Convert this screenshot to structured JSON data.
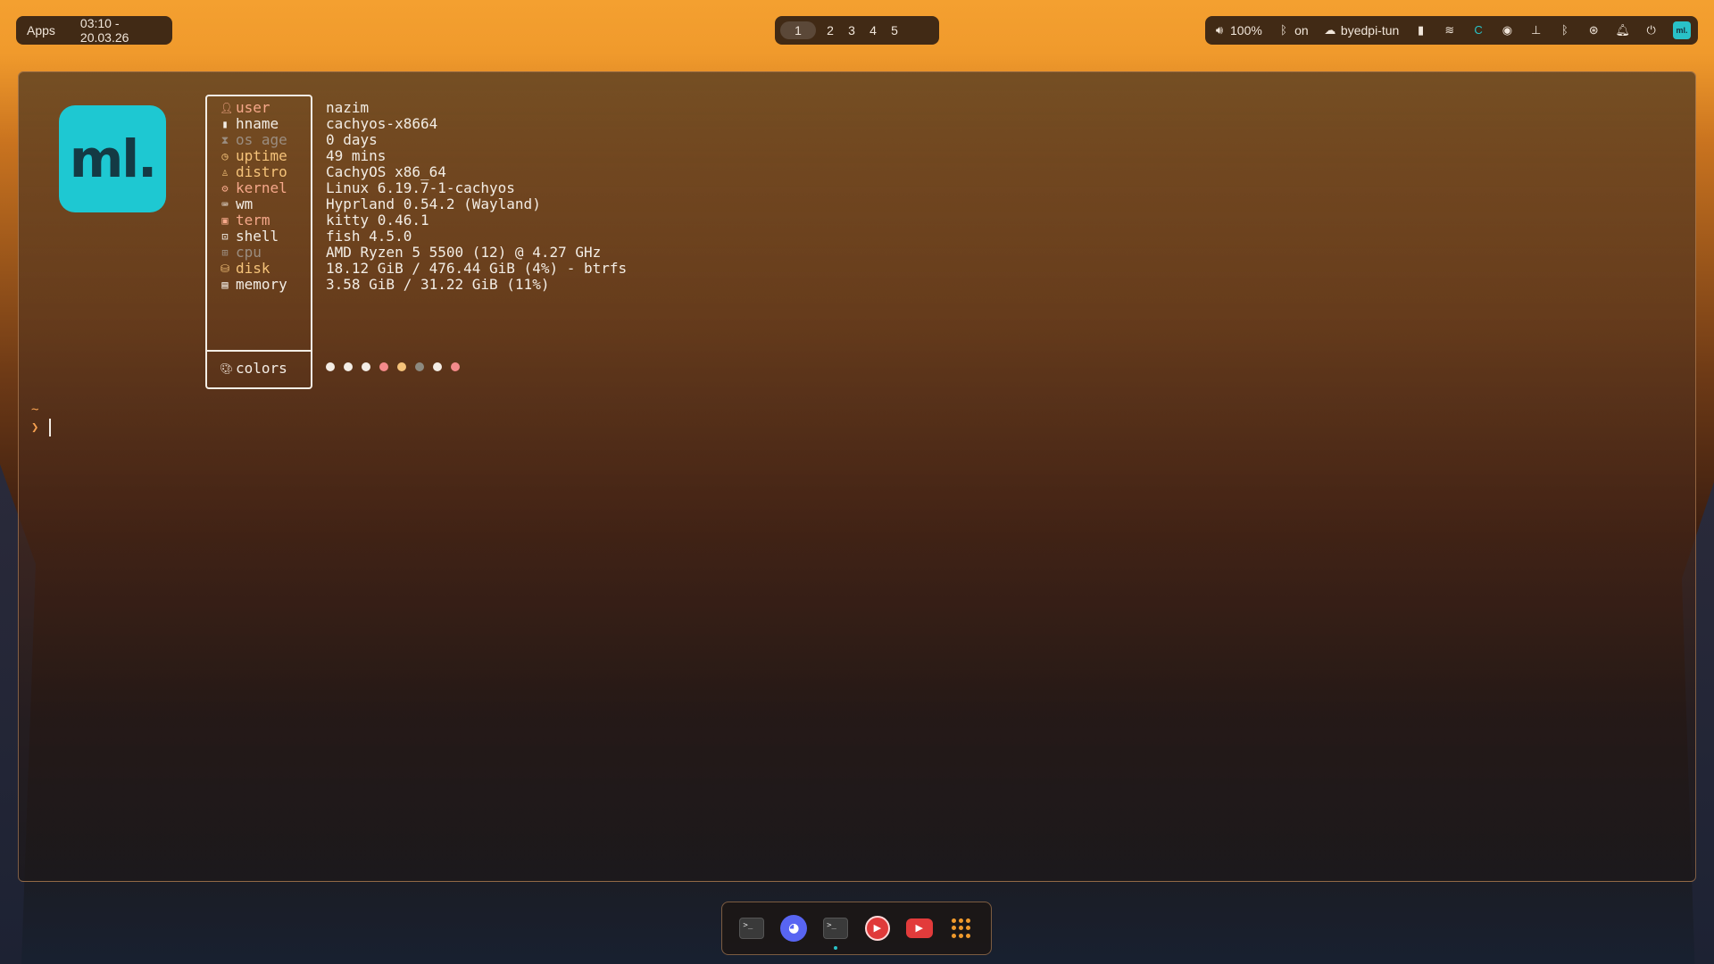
{
  "topbar": {
    "apps_label": "Apps",
    "datetime": "03:10 - 20.03.26",
    "workspaces": [
      "1",
      "2",
      "3",
      "4",
      "5"
    ],
    "active_workspace": "1",
    "volume": "100%",
    "bluetooth_status": "on",
    "vpn": "byedpi-tun",
    "app_badge": "ml."
  },
  "terminal": {
    "logo": "ml.",
    "info": [
      {
        "label": "user",
        "value": "nazim",
        "color": "#f6a88a",
        "icon": "user-icon"
      },
      {
        "label": "hname",
        "value": "cachyos-x8664",
        "color": "#f3ede5",
        "icon": "host-icon"
      },
      {
        "label": "os age",
        "value": "0 days",
        "color": "#9b8d80",
        "icon": "hourglass-icon"
      },
      {
        "label": "uptime",
        "value": "49 mins",
        "color": "#f5c37a",
        "icon": "clock-icon"
      },
      {
        "label": "distro",
        "value": "CachyOS x86_64",
        "color": "#f5c37a",
        "icon": "linux-icon"
      },
      {
        "label": "kernel",
        "value": "Linux 6.19.7-1-cachyos",
        "color": "#f6a88a",
        "icon": "gear-icon"
      },
      {
        "label": "wm",
        "value": "Hyprland 0.54.2 (Wayland)",
        "color": "#f3ede5",
        "icon": "keyboard-icon"
      },
      {
        "label": "term",
        "value": "kitty 0.46.1",
        "color": "#f6a88a",
        "icon": "kitty-icon"
      },
      {
        "label": "shell",
        "value": "fish 4.5.0",
        "color": "#f3ede5",
        "icon": "terminal-icon"
      },
      {
        "label": "cpu",
        "value": "AMD Ryzen 5 5500 (12) @ 4.27 GHz",
        "color": "#9b8d80",
        "icon": "cpu-icon"
      },
      {
        "label": "disk",
        "value": "18.12 GiB / 476.44 GiB (4%) - btrfs",
        "color": "#f5c37a",
        "icon": "disk-icon"
      },
      {
        "label": "memory",
        "value": "3.58 GiB / 31.22 GiB (11%)",
        "color": "#f3ede5",
        "icon": "memory-icon"
      }
    ],
    "colors_label": "colors",
    "palette": [
      "#f3ede5",
      "#f3ede5",
      "#f3ede5",
      "#f48a8a",
      "#f5c37a",
      "#8c8a80",
      "#f3ede5",
      "#f48a8a"
    ],
    "prompt_dir": "~",
    "prompt_symbol": "❯"
  },
  "dock": {
    "apps": [
      "terminal",
      "discord",
      "terminal",
      "screen-recorder",
      "youtube",
      "app-launcher"
    ]
  }
}
